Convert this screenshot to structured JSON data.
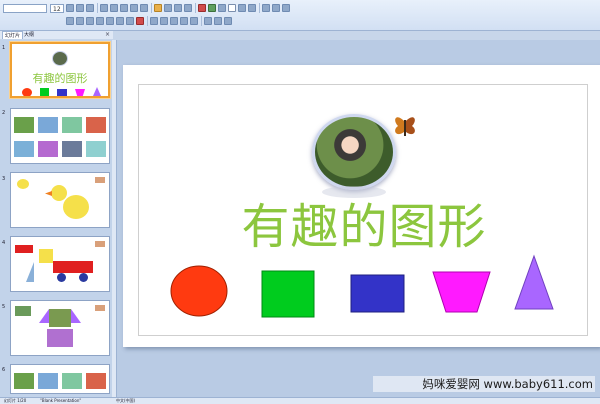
{
  "toolbar": {
    "font_name": "",
    "font_size": "12"
  },
  "panel_tabs": {
    "slides_tab": "幻灯片",
    "outline_tab": "大纲",
    "close": "×"
  },
  "slides": [
    {
      "number": "1",
      "selected": true,
      "title": "有趣的图形"
    },
    {
      "number": "2",
      "selected": false
    },
    {
      "number": "3",
      "selected": false
    },
    {
      "number": "4",
      "selected": false
    },
    {
      "number": "5",
      "selected": false
    },
    {
      "number": "6",
      "selected": false
    }
  ],
  "main_slide": {
    "title": "有趣的图形",
    "shapes": [
      {
        "shape": "circle",
        "color": "#ff3a10"
      },
      {
        "shape": "square",
        "color": "#00cc1e"
      },
      {
        "shape": "rectangle",
        "color": "#3333c8"
      },
      {
        "shape": "trapezoid",
        "color": "#ff1aff"
      },
      {
        "shape": "triangle",
        "color": "#a966ff"
      }
    ]
  },
  "status_bar": {
    "slide_counter": "幻灯片 1/20",
    "theme": "\"Blank Presentation\"",
    "language": "中文(中国)"
  },
  "watermark": "妈咪爱婴网 www.baby611.com",
  "colors": {
    "title_green": "#8cc63e",
    "selection_orange": "#f0a030"
  }
}
